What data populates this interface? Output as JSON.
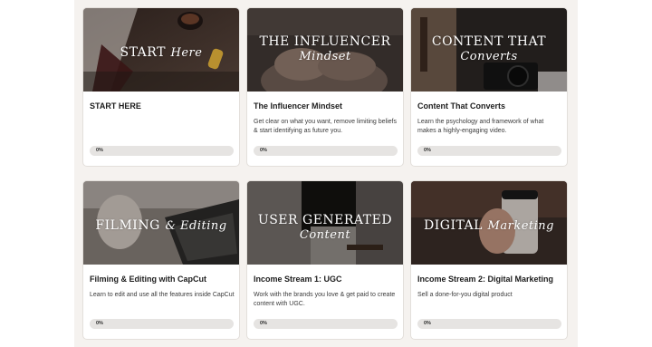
{
  "courses": [
    {
      "thumb_line1": "START",
      "thumb_line2": "Here",
      "title": "START HERE",
      "description": "",
      "progress_label": "0%",
      "progress": 0,
      "image": "coffee-and-laptop-photo"
    },
    {
      "thumb_line1": "THE INFLUENCER",
      "thumb_line2": "Mindset",
      "title": "The Influencer Mindset",
      "description": "Get clear on what you want, remove limiting beliefs & start identifying as future you.",
      "progress_label": "0%",
      "progress": 0,
      "image": "seated-woman-photo"
    },
    {
      "thumb_line1": "CONTENT THAT",
      "thumb_line2": "Converts",
      "title": "Content That Converts",
      "description": "Learn the psychology and framework of what makes a highly-engaging video.",
      "progress_label": "0%",
      "progress": 0,
      "image": "camera-gear-photo"
    },
    {
      "thumb_line1": "FILMING",
      "thumb_line2": "& Editing",
      "title": "Filming & Editing with CapCut",
      "description": "Learn to edit and use all the features inside CapCut",
      "progress_label": "0%",
      "progress": 0,
      "image": "laptop-typing-photo"
    },
    {
      "thumb_line1": "USER GENERATED",
      "thumb_line2": "Content",
      "title": "Income Stream 1: UGC",
      "description": "Work with the brands you love & get paid to create content with UGC.",
      "progress_label": "0%",
      "progress": 0,
      "image": "woman-on-stool-photo"
    },
    {
      "thumb_line1": "DIGITAL",
      "thumb_line2": "Marketing",
      "title": "Income Stream 2: Digital Marketing",
      "description": "Sell a done-for-you digital product",
      "progress_label": "0%",
      "progress": 0,
      "image": "hand-holding-cup-photo"
    }
  ],
  "colors": {
    "panel_background": "#f5f2ef",
    "card_background": "#ffffff",
    "progress_track": "#e6e4e2",
    "title_text": "#1c1c1c"
  }
}
